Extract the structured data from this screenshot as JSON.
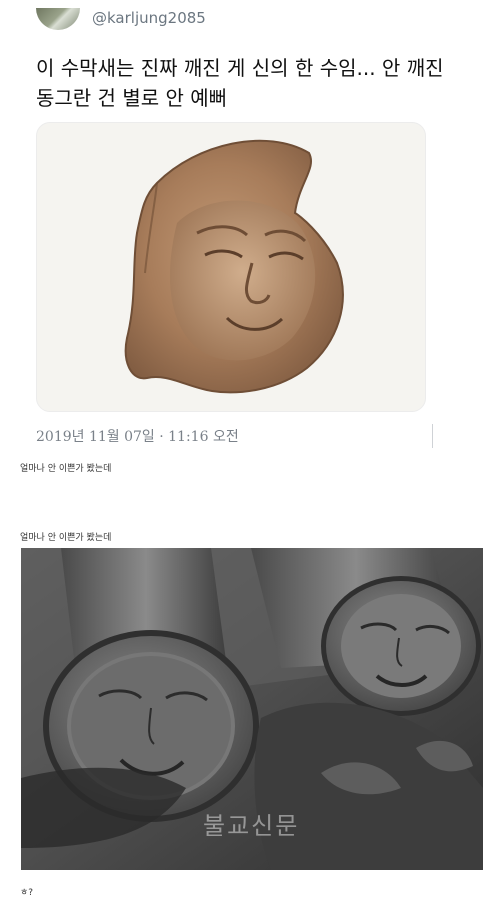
{
  "tweet": {
    "handle": "@karljung2085",
    "text": "이 수막새는 진짜 깨진 게 신의 한 수임... 안 깨진 동그란 건 별로 안 예뻐",
    "timestamp": "2019년 11월 07일 · 11:16 오전"
  },
  "captions": {
    "first": "얼마나 안 이쁜가 봤는데",
    "second": "얼마나 안 이쁜가 봤는데",
    "bottom": "ㅎ?"
  },
  "photo": {
    "watermark": "불교신문"
  },
  "icons": {
    "avatar": "profile-avatar"
  }
}
